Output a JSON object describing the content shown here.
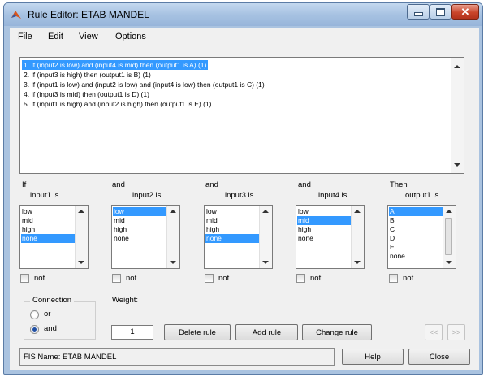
{
  "window": {
    "title": "Rule Editor: ETAB MANDEL"
  },
  "menu": [
    "File",
    "Edit",
    "View",
    "Options"
  ],
  "rules": [
    "1. If (input2 is low) and (input4 is mid) then (output1 is A) (1)",
    "2. If (input3 is high) then (output1 is B) (1)",
    "3. If (input1 is low) and (input2 is low) and (input4 is low) then (output1 is C) (1)",
    "4. If (input3 is mid) then (output1 is D) (1)",
    "5. If (input1 is high) and (input2 is high) then (output1 is E) (1)"
  ],
  "selected_rule_index": 0,
  "columns": [
    {
      "op": "If",
      "label": "input1 is",
      "items": [
        "low",
        "mid",
        "high",
        "none"
      ],
      "selected": "none",
      "not_label": "not"
    },
    {
      "op": "and",
      "label": "input2 is",
      "items": [
        "low",
        "mid",
        "high",
        "none"
      ],
      "selected": "low",
      "not_label": "not"
    },
    {
      "op": "and",
      "label": "input3 is",
      "items": [
        "low",
        "mid",
        "high",
        "none"
      ],
      "selected": "none",
      "not_label": "not"
    },
    {
      "op": "and",
      "label": "input4 is",
      "items": [
        "low",
        "mid",
        "high",
        "none"
      ],
      "selected": "mid",
      "not_label": "not"
    },
    {
      "op": "Then",
      "label": "output1 is",
      "items": [
        "A",
        "B",
        "C",
        "D",
        "E",
        "none"
      ],
      "selected": "A",
      "not_label": "not"
    }
  ],
  "connection": {
    "title": "Connection",
    "options": [
      "or",
      "and"
    ],
    "selected": "and"
  },
  "weight": {
    "label": "Weight:",
    "value": "1"
  },
  "buttons": {
    "delete_rule": "Delete rule",
    "add_rule": "Add rule",
    "change_rule": "Change rule",
    "prev": "<<",
    "next": ">>",
    "help": "Help",
    "close": "Close"
  },
  "status": "FIS Name: ETAB MANDEL",
  "colors": {
    "selection": "#3399ff",
    "title_bar": "#aac3e0",
    "close_button": "#c9452b"
  }
}
